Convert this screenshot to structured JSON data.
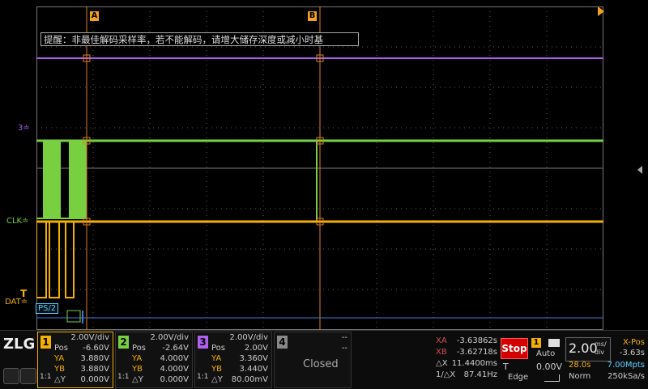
{
  "cursor_markers": {
    "a": "A",
    "b": "B"
  },
  "hint": "提醒：非最佳解码采样率，若不能解码，请增大储存深度或减小时基",
  "channel_labels": {
    "ch3": "3",
    "clk": "CLK",
    "dat": "DAT",
    "protocol": "PS/2"
  },
  "colors": {
    "ch1": "#f4b000",
    "ch2": "#78d040",
    "ch3": "#b060f0",
    "cursor": "#e08020",
    "decode": "#5ad0ff"
  },
  "channels": [
    {
      "num": "1",
      "vdiv": "2.00V/div",
      "pos_label": "Pos",
      "pos": "-6.60V",
      "ya_label": "YA",
      "ya": "3.880V",
      "yb_label": "YB",
      "yb": "3.880V",
      "dy_label": "△Y",
      "dy": "0.000V",
      "coupling": "1:1"
    },
    {
      "num": "2",
      "vdiv": "2.00V/div",
      "pos_label": "Pos",
      "pos": "-2.64V",
      "ya_label": "YA",
      "ya": "4.000V",
      "yb_label": "YB",
      "yb": "4.000V",
      "dy_label": "△Y",
      "dy": "0.000V",
      "coupling": "1:1"
    },
    {
      "num": "3",
      "vdiv": "2.00V/div",
      "pos_label": "Pos",
      "pos": "2.00V",
      "ya_label": "YA",
      "ya": "3.360V",
      "yb_label": "YB",
      "yb": "3.440V",
      "dy_label": "△Y",
      "dy": "80.00mV",
      "coupling": "1:1"
    },
    {
      "num": "4",
      "vdiv": "--",
      "pos": "--",
      "state": "Closed"
    }
  ],
  "cursors": {
    "xa_label": "XA",
    "xa": "-3.63862s",
    "xb_label": "XB",
    "xb": "-3.62718s",
    "dx_label": "△X",
    "dx": "11.4400ms",
    "inv_dx_label": "1/△X",
    "inv_dx": "87.41Hz"
  },
  "trigger": {
    "run_state": "Stop",
    "source": "1",
    "mode": "Auto",
    "type_label": "T",
    "level": "0.00V",
    "edge_label": "Edge"
  },
  "timebase": {
    "value": "2.00",
    "unit_top": "ms/",
    "unit_bottom": "div",
    "xpos_label": "X-Pos",
    "xpos": "-3.63s",
    "span": "28.0s",
    "depth": "7.00Mpts",
    "acq_mode": "Norm",
    "sample_rate": "250kSa/s"
  }
}
